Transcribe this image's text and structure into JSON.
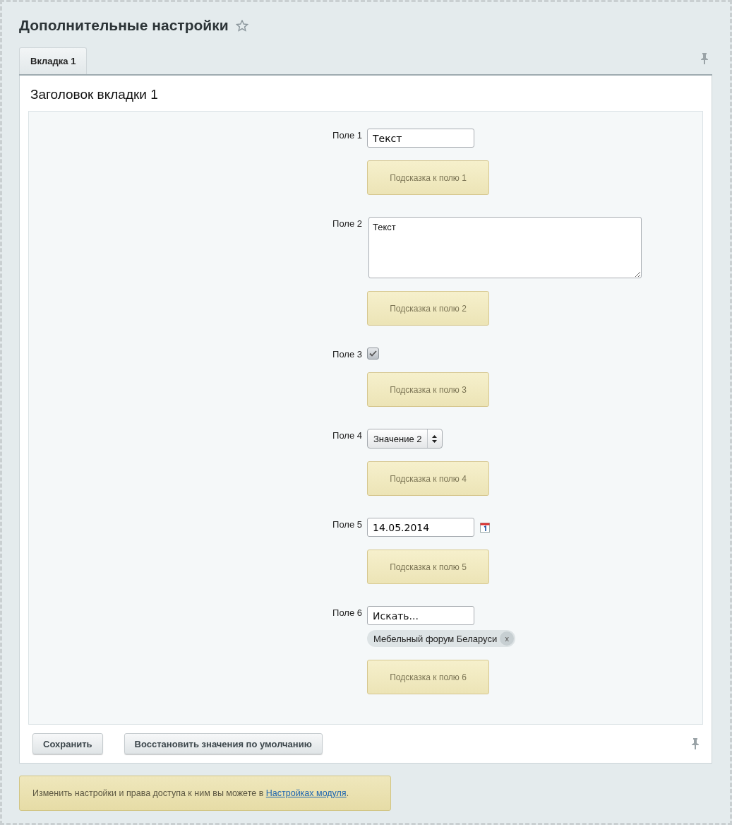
{
  "page": {
    "title": "Дополнительные настройки",
    "favorite": false
  },
  "tabs": [
    {
      "label": "Вкладка 1",
      "selected": true
    }
  ],
  "section_title": "Заголовок вкладки 1",
  "fields": [
    {
      "label": "Поле 1",
      "kind": "text",
      "value": "Текст",
      "hint": "Подсказка к полю 1"
    },
    {
      "label": "Поле 2",
      "kind": "textarea",
      "value": "Текст",
      "hint": "Подсказка к полю 2"
    },
    {
      "label": "Поле 3",
      "kind": "checkbox",
      "checked": true,
      "hint": "Подсказка к полю 3"
    },
    {
      "label": "Поле 4",
      "kind": "select",
      "value": "Значение 2",
      "hint": "Подсказка к полю 4"
    },
    {
      "label": "Поле 5",
      "kind": "date",
      "value": "14.05.2014",
      "hint": "Подсказка к полю 5"
    },
    {
      "label": "Поле 6",
      "kind": "search",
      "placeholder": "Искать...",
      "tags": [
        {
          "label": "Мебельный форум Беларуси",
          "remove": "x"
        }
      ],
      "hint": "Подсказка к полю 6"
    }
  ],
  "buttons": [
    "Сохранить",
    "Восстановить значения по умолчанию"
  ],
  "note": {
    "text": "Изменить настройки и права доступа к ним вы можете в ",
    "link": "Настройках модуля",
    "after": "."
  }
}
